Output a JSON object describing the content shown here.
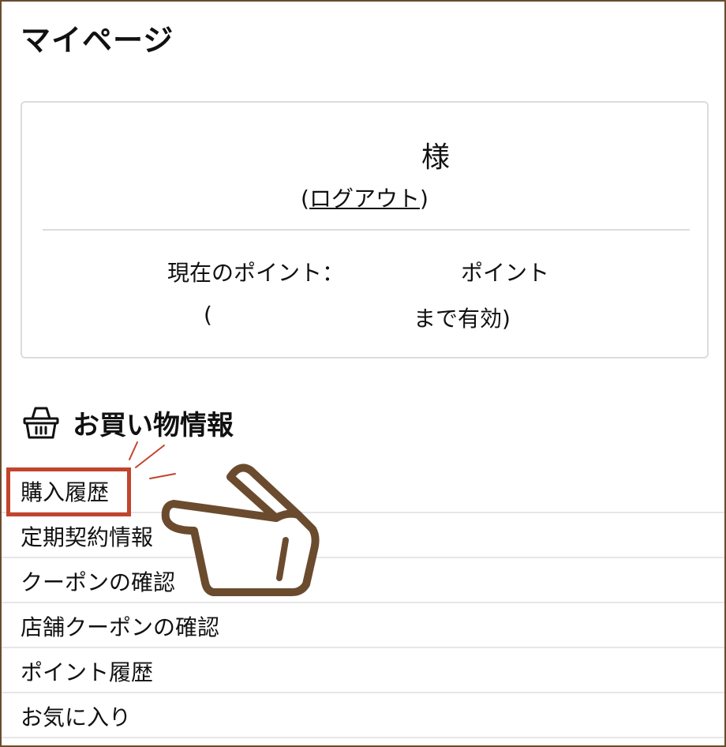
{
  "page": {
    "title": "マイページ"
  },
  "account": {
    "name_suffix": "様",
    "logout_open": "(",
    "logout_label": "ログアウト",
    "logout_close": ")",
    "points_label": "現在のポイント：",
    "points_unit": "ポイント",
    "expiry_open": "(",
    "expiry_suffix": "まで有効)"
  },
  "shopping": {
    "icon": "basket-icon",
    "title": "お買い物情報",
    "items": [
      {
        "label": "購入履歴"
      },
      {
        "label": "定期契約情報"
      },
      {
        "label": "クーポンの確認"
      },
      {
        "label": "店舗クーポンの確認"
      },
      {
        "label": "ポイント履歴"
      },
      {
        "label": "お気に入り"
      }
    ]
  },
  "annotation": {
    "highlight_color": "#c1452d",
    "pointer_color": "#6b4b2e",
    "pointer_icon": "pointing-hand-icon"
  }
}
